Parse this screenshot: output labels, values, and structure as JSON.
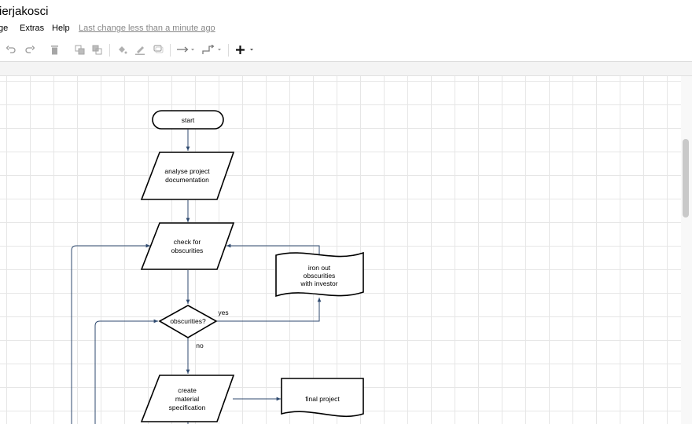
{
  "window": {
    "title": "ierjakosci"
  },
  "menu": {
    "items": [
      "ge",
      "Extras",
      "Help"
    ],
    "last_change": "Last change less than a minute ago"
  },
  "toolbar": {
    "icons": [
      "undo-icon",
      "redo-icon",
      "delete-icon",
      "to-front-icon",
      "to-back-icon",
      "fill-color-icon",
      "line-color-icon",
      "shadow-icon",
      "connection-icon",
      "waypoints-icon",
      "insert-icon"
    ]
  },
  "diagram": {
    "start": "start",
    "analyse": [
      "analyse project",
      "documentation"
    ],
    "check": [
      "check for",
      "obscurities"
    ],
    "iron": [
      "iron out",
      "obscurities",
      "with investor"
    ],
    "decision": "obscurities?",
    "yes": "yes",
    "no": "no",
    "create": [
      "create",
      "material",
      "specification"
    ],
    "final": "final project"
  },
  "colors": {
    "arrow": "#2f4a6f",
    "shape_stroke": "#000000",
    "grid": "#e6e6e6"
  }
}
